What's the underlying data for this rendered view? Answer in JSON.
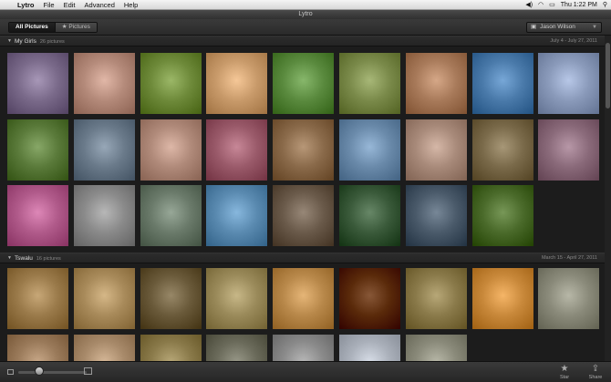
{
  "menubar": {
    "app": "Lytro",
    "items": [
      "File",
      "Edit",
      "Advanced",
      "Help"
    ],
    "clock": "Thu 1:22 PM",
    "battery_icon": "battery-icon",
    "wifi_icon": "wifi-icon",
    "search_icon": "spotlight-icon"
  },
  "window": {
    "title": "Lytro"
  },
  "toolbar": {
    "all_pictures": "All Pictures",
    "pictures": "Pictures",
    "user": "Jason Wilson"
  },
  "sections": [
    {
      "name": "My Girls",
      "count": "26 pictures",
      "date": "July 4 - July 27, 2011",
      "thumbs": [
        "#7a6a8a",
        "#b48a7a",
        "#6e8a3a",
        "#c89a6a",
        "#5a8a3e",
        "#7a8a4a",
        "#a87a5a",
        "#4a7aaa",
        "#8a9aba",
        "#5a7a3a",
        "#6a7a8a",
        "#b08a7a",
        "#9a5a6a",
        "#8a6a4a",
        "#6a8aaa",
        "#a88a7a",
        "#7a6a4a",
        "#8a6a7a",
        "#b05a8a",
        "#8a8a8a",
        "#6a7a6a",
        "#5a8ab0",
        "#6a5a4a",
        "#3a5a3a",
        "#4a5a6a",
        "#4a6a2a"
      ]
    },
    {
      "name": "Tswalu",
      "count": "16 pictures",
      "date": "March 15 - April 27, 2011",
      "thumbs": [
        "#9a7a4a",
        "#a88a5a",
        "#6a5a3a",
        "#9a8a5a",
        "#b8884a",
        "#5a2a0a",
        "#8a7a4a",
        "#c8883a",
        "#8a8a7a",
        "#9a7a5a",
        "#a88a6a",
        "#8a7a4a",
        "#6a6a5a",
        "#8a8a8a",
        "#aab0ba",
        "#8a8a7a"
      ]
    }
  ],
  "bottombar": {
    "zoom_level": 0.3,
    "star_label": "Star",
    "share_label": "Share"
  }
}
